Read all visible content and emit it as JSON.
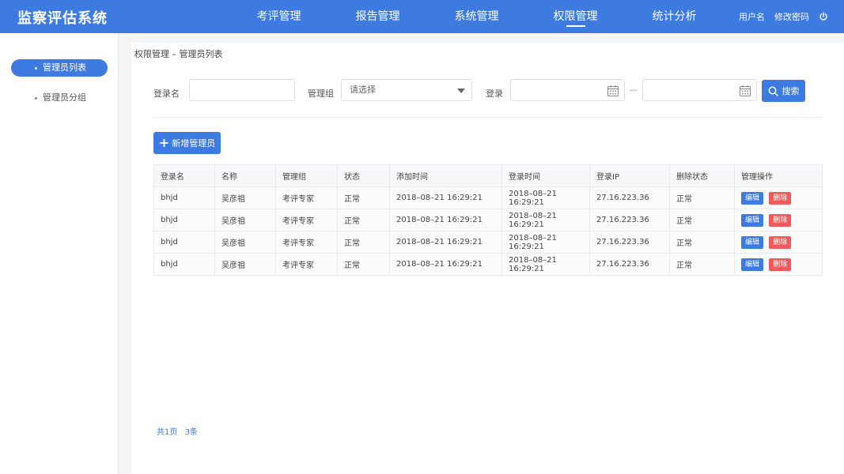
{
  "app": {
    "title": "监察评估系统"
  },
  "nav": {
    "items": [
      {
        "label": "考评管理"
      },
      {
        "label": "报告管理"
      },
      {
        "label": "系统管理"
      },
      {
        "label": "权限管理"
      },
      {
        "label": "统计分析"
      }
    ],
    "active_index": 3
  },
  "user": {
    "name": "用户名",
    "change_password": "修改密码"
  },
  "sidebar": {
    "items": [
      {
        "label": "管理员列表"
      },
      {
        "label": "管理员分组"
      }
    ],
    "active_index": 0
  },
  "breadcrumb": {
    "text": "权限管理 – 管理员列表"
  },
  "filters": {
    "login_name_label": "登录名",
    "login_name_value": "",
    "group_label": "管理组",
    "group_placeholder": "请选择",
    "login_label": "登录",
    "date_start": "",
    "date_separator": "—",
    "date_end": "",
    "search_label": "搜索"
  },
  "add_button": {
    "label": "新增管理员"
  },
  "table": {
    "columns": [
      "登录名",
      "名称",
      "管理组",
      "状态",
      "添加时间",
      "登录时间",
      "登录IP",
      "删除状态",
      "管理操作"
    ],
    "rows": [
      [
        "bhjd",
        "吴彦祖",
        "考评专家",
        "正常",
        "2018–08–21  16:29:21",
        "2018–08–21  16:29:21",
        "27.16.223.36",
        "正常"
      ],
      [
        "bhjd",
        "吴彦祖",
        "考评专家",
        "正常",
        "2018–08–21  16:29:21",
        "2018–08–21  16:29:21",
        "27.16.223.36",
        "正常"
      ],
      [
        "bhjd",
        "吴彦祖",
        "考评专家",
        "正常",
        "2018–08–21  16:29:21",
        "2018–08–21  16:29:21",
        "27.16.223.36",
        "正常"
      ],
      [
        "bhjd",
        "吴彦祖",
        "考评专家",
        "正常",
        "2018–08–21  16:29:21",
        "2018–08–21  16:29:21",
        "27.16.223.36",
        "正常"
      ]
    ],
    "edit_label": "编辑",
    "delete_label": "删除"
  },
  "pager": {
    "pages": "共1页",
    "count": "3条"
  },
  "colors": {
    "primary": "#3d7be0",
    "danger": "#f05a5a"
  }
}
